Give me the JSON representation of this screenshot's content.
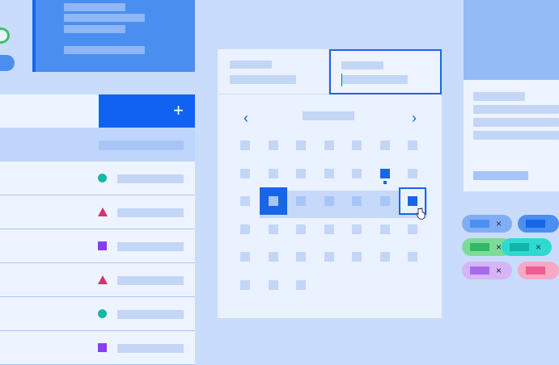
{
  "list": {
    "add_label": "+",
    "rows": [
      {
        "shape": "circle"
      },
      {
        "shape": "triangle"
      },
      {
        "shape": "square"
      },
      {
        "shape": "triangle"
      },
      {
        "shape": "circle"
      },
      {
        "shape": "square"
      }
    ]
  },
  "calendar": {
    "prev_label": "‹",
    "next_label": "›",
    "weeks": 6,
    "days_per_week": 7,
    "range_start": {
      "week": 2,
      "day": 1
    },
    "range_end": {
      "week": 2,
      "day": 6
    },
    "today": {
      "week": 1,
      "day": 5
    },
    "last_week_days": 3
  },
  "chips": [
    {
      "color": "#80aef5",
      "label_color": "#4b8ff0",
      "close": "×"
    },
    {
      "color": "#7ddb9a",
      "label_color": "#34b865",
      "close": "×"
    },
    {
      "color": "#d7b3f7",
      "label_color": "#a66ce8",
      "close": "×"
    }
  ],
  "chips_col2": [
    {
      "color": "#4b8ff0",
      "label_color": "#1766e8"
    },
    {
      "color": "#2ed9d0",
      "label_color": "#12b3ab",
      "close": "×"
    },
    {
      "color": "#f7a8c5",
      "label_color": "#ee5c93"
    }
  ],
  "colors": {
    "accent": "#1766e8",
    "circle": "#14b8a6",
    "triangle": "#d6336c",
    "square": "#8b3cf0"
  }
}
